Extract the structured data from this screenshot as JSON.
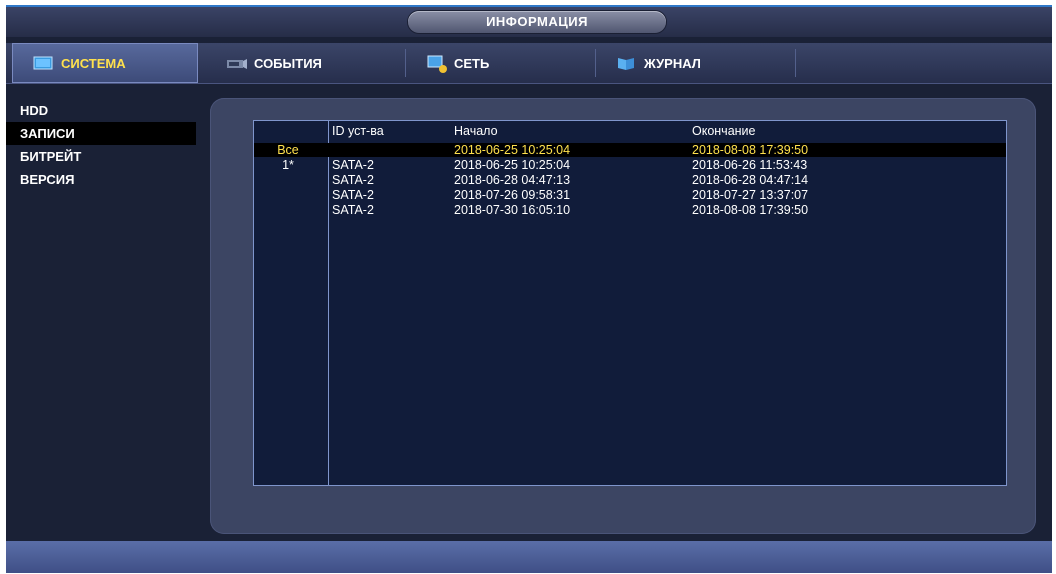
{
  "window": {
    "title": "ИНФОРМАЦИЯ"
  },
  "tabs": [
    {
      "label": "СИСТЕМА",
      "icon": "monitor-icon",
      "active": true
    },
    {
      "label": "СОБЫТИЯ",
      "icon": "camera-icon",
      "active": false
    },
    {
      "label": "СЕТЬ",
      "icon": "network-icon",
      "active": false
    },
    {
      "label": "ЖУРНАЛ",
      "icon": "log-icon",
      "active": false
    }
  ],
  "sidebar": {
    "items": [
      {
        "label": "HDD",
        "active": false
      },
      {
        "label": "ЗАПИСИ",
        "active": true
      },
      {
        "label": "БИТРЕЙТ",
        "active": false
      },
      {
        "label": "ВЕРСИЯ",
        "active": false
      }
    ]
  },
  "records_table": {
    "headers": [
      "",
      "ID уст-ва",
      "Начало",
      "Окончание"
    ],
    "rows": [
      {
        "index": "Все",
        "device": "",
        "start": "2018-06-25 10:25:04",
        "end": "2018-08-08 17:39:50",
        "selected": true
      },
      {
        "index": "1*",
        "device": "SATA-2",
        "start": "2018-06-25 10:25:04",
        "end": "2018-06-26 11:53:43",
        "selected": false
      },
      {
        "index": "",
        "device": "SATA-2",
        "start": "2018-06-28 04:47:13",
        "end": "2018-06-28 04:47:14",
        "selected": false
      },
      {
        "index": "",
        "device": "SATA-2",
        "start": "2018-07-26 09:58:31",
        "end": "2018-07-27 13:37:07",
        "selected": false
      },
      {
        "index": "",
        "device": "SATA-2",
        "start": "2018-07-30 16:05:10",
        "end": "2018-08-08 17:39:50",
        "selected": false
      }
    ]
  },
  "colors": {
    "accent": "#ffe14d",
    "background": "#1a2136",
    "panel": "#3c4563",
    "table_bg": "#111c3a"
  }
}
